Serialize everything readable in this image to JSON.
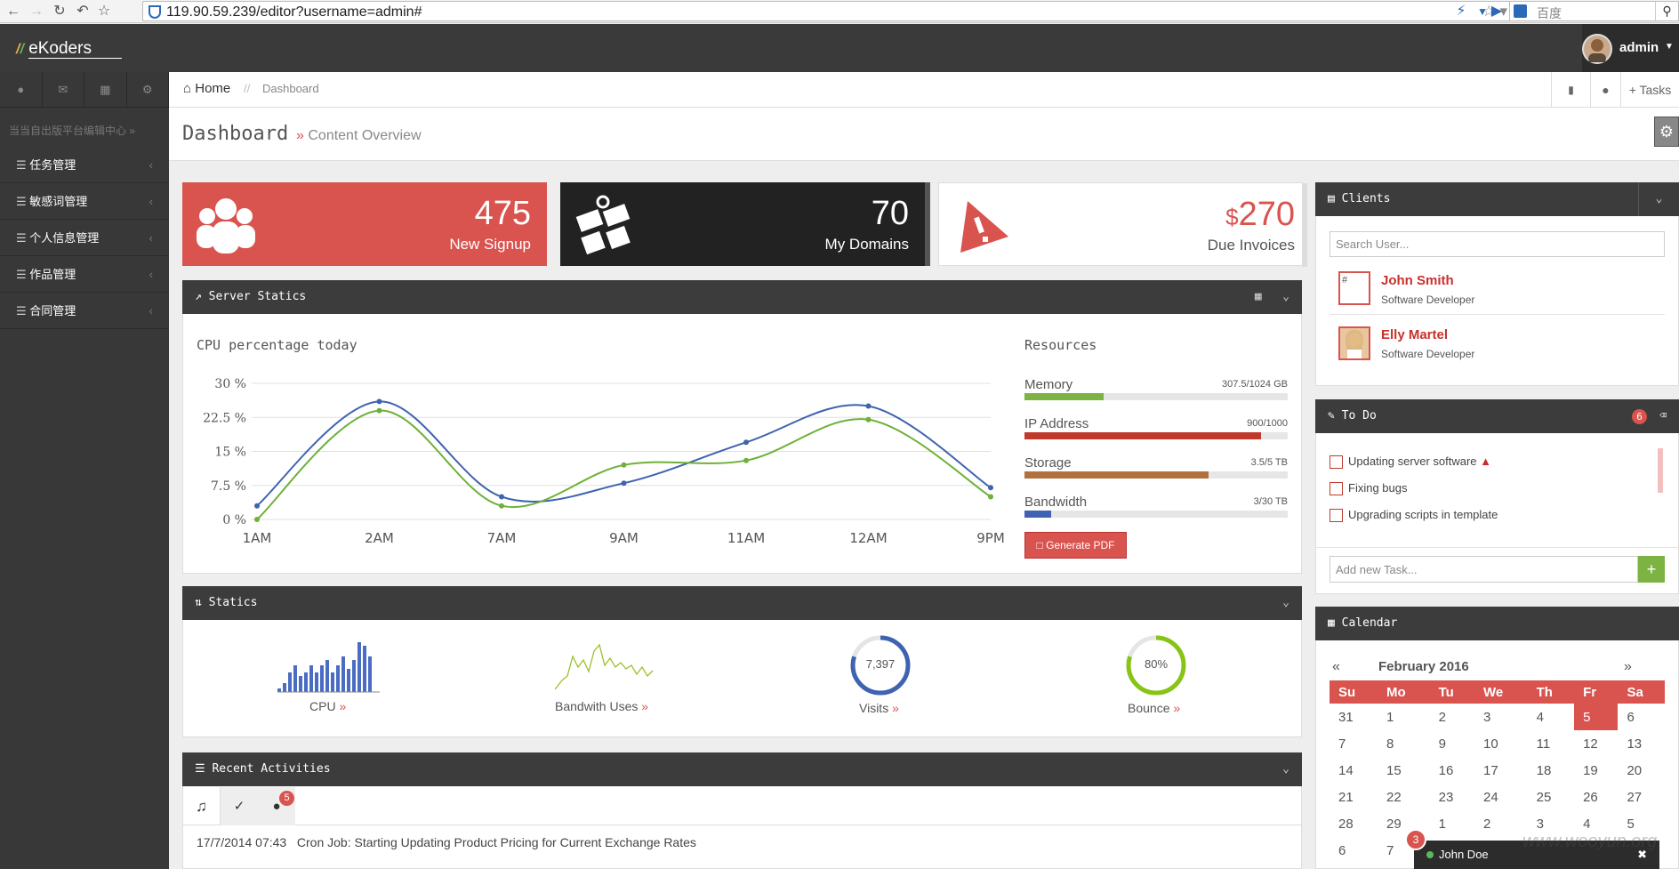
{
  "browser": {
    "url": "119.90.59.239/editor?username=admin#",
    "search_placeholder": "百度"
  },
  "app": {
    "logo": "eKoders",
    "user": "admin"
  },
  "sidebar": {
    "section_label": "当当自出版平台编辑中心",
    "items": [
      {
        "label": "任务管理"
      },
      {
        "label": "敏感词管理"
      },
      {
        "label": "个人信息管理"
      },
      {
        "label": "作品管理"
      },
      {
        "label": "合同管理"
      }
    ]
  },
  "breadcrumb": {
    "home": "Home",
    "separator": "//",
    "current": "Dashboard"
  },
  "topnav": {
    "tasks": "Tasks"
  },
  "page": {
    "title": "Dashboard",
    "subtitle": "Content Overview"
  },
  "tiles": [
    {
      "value": "475",
      "label": "New Signup",
      "color": "#d9534f"
    },
    {
      "value": "70",
      "label": "My Domains",
      "color": "#222222"
    },
    {
      "currency": "$",
      "value": "270",
      "label": "Due Invoices",
      "color": "#d9534f"
    }
  ],
  "server": {
    "panel_title": "Server Statics",
    "chart_title": "CPU percentage today",
    "resources_title": "Resources",
    "resources": [
      {
        "label": "Memory",
        "value": "307.5/1024 GB",
        "fraction": 0.3,
        "color": "#7cb342"
      },
      {
        "label": "IP Address",
        "value": "900/1000",
        "fraction": 0.9,
        "color": "#c0392b"
      },
      {
        "label": "Storage",
        "value": "3.5/5 TB",
        "fraction": 0.7,
        "color": "#b0713f"
      },
      {
        "label": "Bandwidth",
        "value": "3/30 TB",
        "fraction": 0.1,
        "color": "#3f63b0"
      }
    ],
    "pdf_button": "Generate PDF"
  },
  "chart_data": {
    "type": "line",
    "categories": [
      "1AM",
      "2AM",
      "7AM",
      "9AM",
      "11AM",
      "12AM",
      "9PM"
    ],
    "y_ticks": [
      "30 %",
      "22.5 %",
      "15 %",
      "7.5 %",
      "0 %"
    ],
    "ylim": [
      0,
      30
    ],
    "series": [
      {
        "color": "#3f63b0",
        "values": [
          3,
          26,
          5,
          8,
          17,
          25,
          7
        ]
      },
      {
        "color": "#6fb03a",
        "values": [
          0,
          24,
          3,
          12,
          13,
          22,
          5
        ]
      }
    ]
  },
  "statics": {
    "panel_title": "Statics",
    "items": [
      {
        "label": "CPU"
      },
      {
        "label": "Bandwith Uses"
      },
      {
        "label": "Visits",
        "value": "7,397",
        "fraction": 0.8
      },
      {
        "label": "Bounce",
        "value": "80%",
        "fraction": 0.8
      }
    ]
  },
  "activities": {
    "panel_title": "Recent Activities",
    "badge": "5",
    "entries": [
      {
        "time": "17/7/2014 07:43",
        "text": "Cron Job: Starting Updating Product Pricing for Current Exchange Rates"
      }
    ]
  },
  "clients": {
    "panel_title": "Clients",
    "search_placeholder": "Search User...",
    "list": [
      {
        "name": "John Smith",
        "role": "Software Developer",
        "img_alt": "#"
      },
      {
        "name": "Elly Martel",
        "role": "Software Developer"
      }
    ]
  },
  "todo": {
    "panel_title": "To Do",
    "badge": "6",
    "items": [
      {
        "text": "Updating server software"
      },
      {
        "text": "Fixing bugs"
      },
      {
        "text": "Upgrading scripts in template"
      }
    ],
    "input_placeholder": "Add new Task..."
  },
  "calendar": {
    "panel_title": "Calendar",
    "month": "February 2016",
    "prev": "«",
    "next": "»",
    "days": [
      "Su",
      "Mo",
      "Tu",
      "We",
      "Th",
      "Fr",
      "Sa"
    ],
    "weeks": [
      [
        "31",
        "1",
        "2",
        "3",
        "4",
        "5",
        "6"
      ],
      [
        "7",
        "8",
        "9",
        "10",
        "11",
        "12",
        "13"
      ],
      [
        "14",
        "15",
        "16",
        "17",
        "18",
        "19",
        "20"
      ],
      [
        "21",
        "22",
        "23",
        "24",
        "25",
        "26",
        "27"
      ],
      [
        "28",
        "29",
        "1",
        "2",
        "3",
        "4",
        "5"
      ],
      [
        "6",
        "7",
        "",
        "",
        "",
        "",
        ""
      ]
    ],
    "today": "5"
  },
  "chat": {
    "badge": "3",
    "name": "John Doe"
  },
  "watermark": "www.wooyun.org"
}
